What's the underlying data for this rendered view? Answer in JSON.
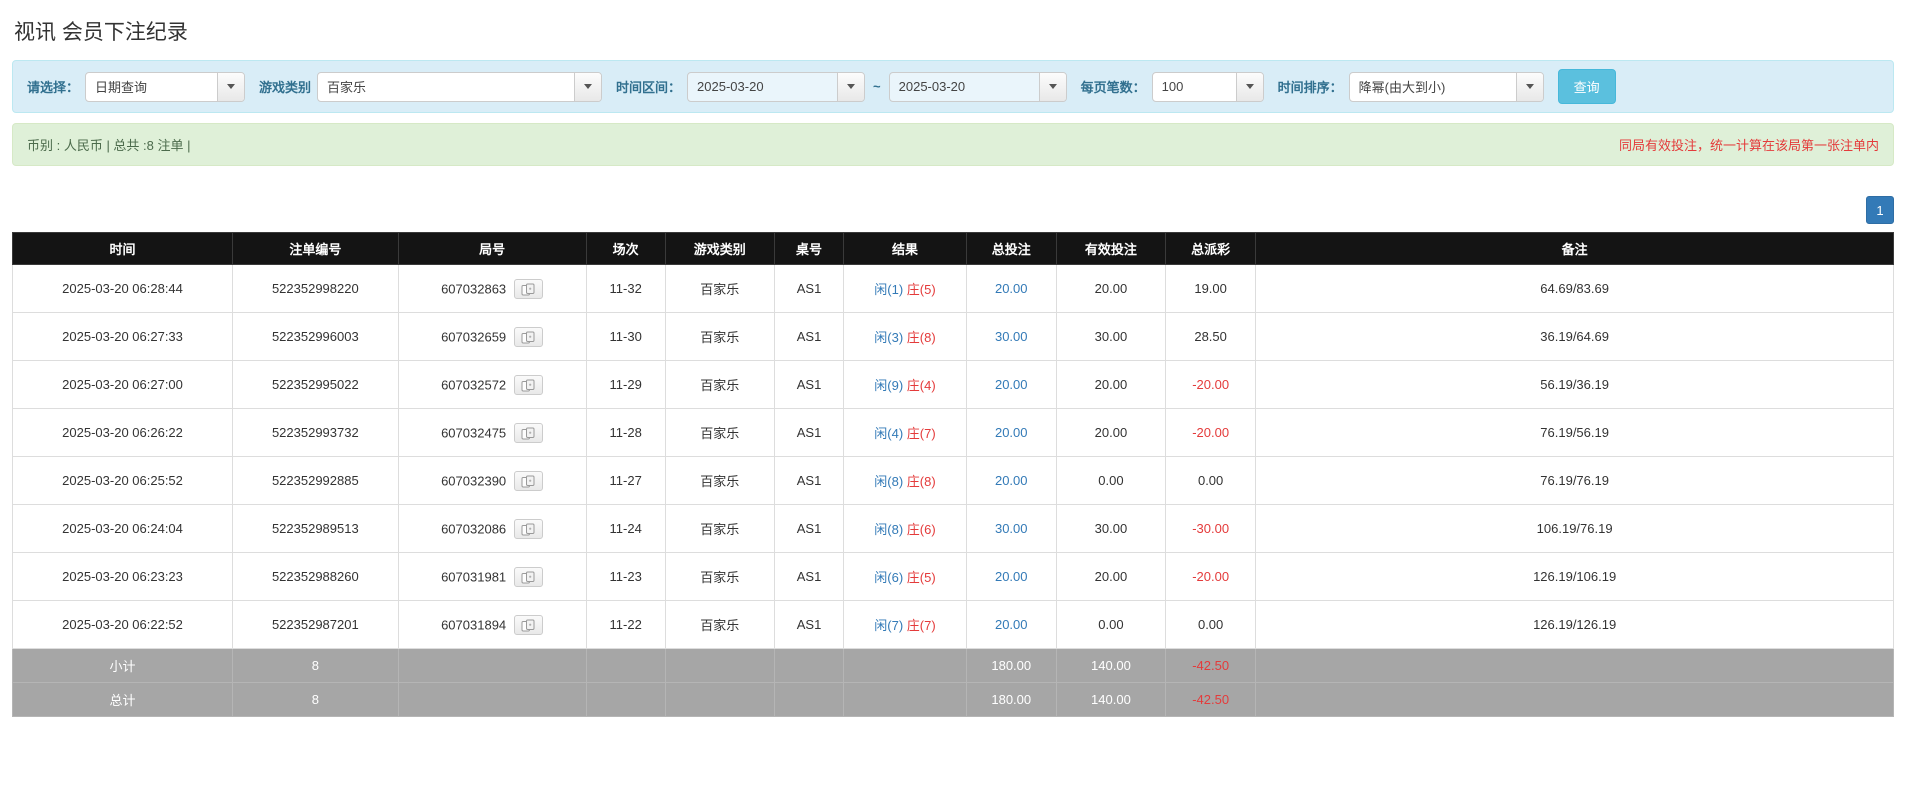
{
  "page_title": "视讯 会员下注纪录",
  "colors": {
    "blue": "#337ab7",
    "red": "#e43b3b",
    "header_bg": "#141414",
    "filter_bg": "#d9edf7",
    "summary_bg": "#dff0d8",
    "footer_bg": "#a6a6a6",
    "button_bg": "#5bc0de"
  },
  "filter": {
    "select_label": "请选择：",
    "select_value": "日期查询",
    "game_type_label": "游戏类别",
    "game_type_value": "百家乐",
    "time_range_label": "时间区间：",
    "date_from": "2025-03-20",
    "tilde": "~",
    "date_to": "2025-03-20",
    "page_size_label": "每页笔数：",
    "page_size_value": "100",
    "sort_label": "时间排序：",
    "sort_value": "降幂(由大到小)",
    "query_button": "查询"
  },
  "summary": {
    "left": "币别 : 人民币 | 总共 :8 注单 |",
    "right": "同局有效投注，统一计算在该局第一张注单内"
  },
  "pagination": {
    "current": "1"
  },
  "table": {
    "headers": [
      "时间",
      "注单编号",
      "局号",
      "场次",
      "游戏类别",
      "桌号",
      "结果",
      "总投注",
      "有效投注",
      "总派彩",
      "备注"
    ],
    "rows": [
      {
        "time": "2025-03-20 06:28:44",
        "bet_id": "522352998220",
        "round_id": "607032863",
        "session": "11-32",
        "game_type": "百家乐",
        "table_no": "AS1",
        "result_player": "闲(1)",
        "result_banker": "庄(5)",
        "total_bet": "20.00",
        "valid_bet": "20.00",
        "payout": "19.00",
        "remark": "64.69/83.69"
      },
      {
        "time": "2025-03-20 06:27:33",
        "bet_id": "522352996003",
        "round_id": "607032659",
        "session": "11-30",
        "game_type": "百家乐",
        "table_no": "AS1",
        "result_player": "闲(3)",
        "result_banker": "庄(8)",
        "total_bet": "30.00",
        "valid_bet": "30.00",
        "payout": "28.50",
        "remark": "36.19/64.69"
      },
      {
        "time": "2025-03-20 06:27:00",
        "bet_id": "522352995022",
        "round_id": "607032572",
        "session": "11-29",
        "game_type": "百家乐",
        "table_no": "AS1",
        "result_player": "闲(9)",
        "result_banker": "庄(4)",
        "total_bet": "20.00",
        "valid_bet": "20.00",
        "payout": "-20.00",
        "remark": "56.19/36.19"
      },
      {
        "time": "2025-03-20 06:26:22",
        "bet_id": "522352993732",
        "round_id": "607032475",
        "session": "11-28",
        "game_type": "百家乐",
        "table_no": "AS1",
        "result_player": "闲(4)",
        "result_banker": "庄(7)",
        "total_bet": "20.00",
        "valid_bet": "20.00",
        "payout": "-20.00",
        "remark": "76.19/56.19"
      },
      {
        "time": "2025-03-20 06:25:52",
        "bet_id": "522352992885",
        "round_id": "607032390",
        "session": "11-27",
        "game_type": "百家乐",
        "table_no": "AS1",
        "result_player": "闲(8)",
        "result_banker": "庄(8)",
        "total_bet": "20.00",
        "valid_bet": "0.00",
        "payout": "0.00",
        "remark": "76.19/76.19"
      },
      {
        "time": "2025-03-20 06:24:04",
        "bet_id": "522352989513",
        "round_id": "607032086",
        "session": "11-24",
        "game_type": "百家乐",
        "table_no": "AS1",
        "result_player": "闲(8)",
        "result_banker": "庄(6)",
        "total_bet": "30.00",
        "valid_bet": "30.00",
        "payout": "-30.00",
        "remark": "106.19/76.19"
      },
      {
        "time": "2025-03-20 06:23:23",
        "bet_id": "522352988260",
        "round_id": "607031981",
        "session": "11-23",
        "game_type": "百家乐",
        "table_no": "AS1",
        "result_player": "闲(6)",
        "result_banker": "庄(5)",
        "total_bet": "20.00",
        "valid_bet": "20.00",
        "payout": "-20.00",
        "remark": "126.19/106.19"
      },
      {
        "time": "2025-03-20 06:22:52",
        "bet_id": "522352987201",
        "round_id": "607031894",
        "session": "11-22",
        "game_type": "百家乐",
        "table_no": "AS1",
        "result_player": "闲(7)",
        "result_banker": "庄(7)",
        "total_bet": "20.00",
        "valid_bet": "0.00",
        "payout": "0.00",
        "remark": "126.19/126.19"
      }
    ],
    "subtotal": {
      "label": "小计",
      "count": "8",
      "total_bet": "180.00",
      "valid_bet": "140.00",
      "payout": "-42.50"
    },
    "total": {
      "label": "总计",
      "count": "8",
      "total_bet": "180.00",
      "valid_bet": "140.00",
      "payout": "-42.50"
    }
  }
}
